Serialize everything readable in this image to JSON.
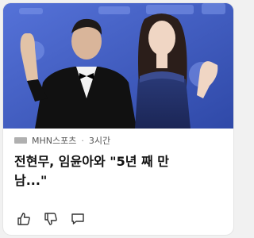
{
  "article": {
    "source": "MHN스포츠",
    "separator": "·",
    "time": "3시간",
    "headline_line1": "전현무, 임윤아와 \"5년 째 만",
    "headline_line2": "남...\""
  },
  "icons": {
    "like": "thumbs-up-icon",
    "dislike": "thumbs-down-icon",
    "comment": "comment-icon"
  },
  "colors": {
    "backdrop": "#3f5ec2",
    "source_logo": "#b0b0b0",
    "icon_stroke": "#333333"
  }
}
